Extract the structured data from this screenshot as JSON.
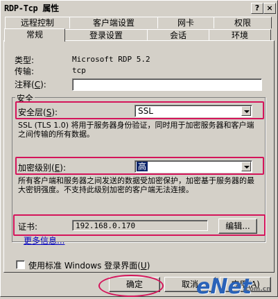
{
  "window": {
    "title": "RDP-Tcp 属性"
  },
  "titlebar": {
    "help_label": "?",
    "close_label": "×"
  },
  "tabs_back": [
    "远程控制",
    "客户端设置",
    "网卡",
    "权限"
  ],
  "tabs_front": [
    "常规",
    "登录设置",
    "会话",
    "环境"
  ],
  "general": {
    "type_label": "类型:",
    "type_value": "Microsoft RDP 5.2",
    "transport_label": "传输:",
    "transport_value": "tcp",
    "comment_label": "注释",
    "comment_key": "C",
    "comment_value": ""
  },
  "security": {
    "group_title": "安全",
    "layer_label": "安全层",
    "layer_key": "S",
    "layer_value": "SSL",
    "layer_desc": "SSL (TLS 1.0) 将用于服务器身份验证，同时用于加密服务器和客户端之间传输的所有数据。",
    "encryption_label": "加密级别",
    "encryption_key": "E",
    "encryption_value": "高",
    "encryption_desc": "所有客户端和服务器之间发送的数据受加密保护，加密基于服务器的最大密钥强度。不支持此级别加密的客户端无法连接。",
    "cert_label": "证书:",
    "cert_value": "192.168.0.170",
    "edit_button": "编辑...",
    "more_info": "更多信息..."
  },
  "options": {
    "use_windows_logon": "使用标准 Windows 登录界面",
    "use_windows_logon_key": "U"
  },
  "buttons": {
    "ok": "确定",
    "cancel": "取消",
    "apply": "应用(A)"
  },
  "watermark": {
    "text": "eNet",
    "sub": ".com.cn"
  },
  "colors": {
    "highlight": "#d4145a",
    "selection": "#0a246a",
    "link": "#0000c0",
    "face": "#d4d0c8"
  }
}
